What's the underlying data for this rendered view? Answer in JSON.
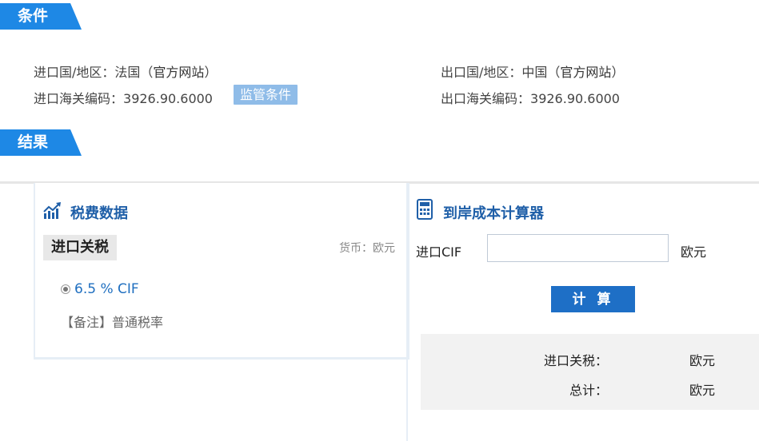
{
  "conditions": {
    "tab_label": "条件",
    "import_country_label": "进口国/地区：",
    "import_country_value": "法国（",
    "import_official_link": "官方网站",
    "import_close_paren": "）",
    "export_country_label": "出口国/地区：",
    "export_country_value": "中国（",
    "export_official_link": "官方网站",
    "export_close_paren": "）",
    "import_hs_label": "进口海关编码：",
    "import_hs_value": "3926.90.6000",
    "monitor_button": "监管条件",
    "export_hs_label": "出口海关编码：",
    "export_hs_value": "3926.90.6000"
  },
  "results": {
    "tab_label": "结果",
    "tax_panel": {
      "title": "税费数据",
      "import_duty_tag": "进口关税",
      "currency_text": "货币：欧元",
      "rate_text": "6.5 % CIF",
      "remark_text": "【备注】普通税率"
    },
    "calculator": {
      "title": "到岸成本计算器",
      "cif_label": "进口CIF",
      "cif_value": "",
      "cif_unit": "欧元",
      "calc_button": "计 算",
      "duty_label": "进口关税：",
      "duty_unit": "欧元",
      "total_label": "总计：",
      "total_unit": "欧元"
    }
  },
  "colors": {
    "tab_blue": "#1e88e5",
    "title_blue": "#1f5fa8",
    "button_blue": "#1e6fc6",
    "monitor_button_bg": "#8fbce8"
  }
}
